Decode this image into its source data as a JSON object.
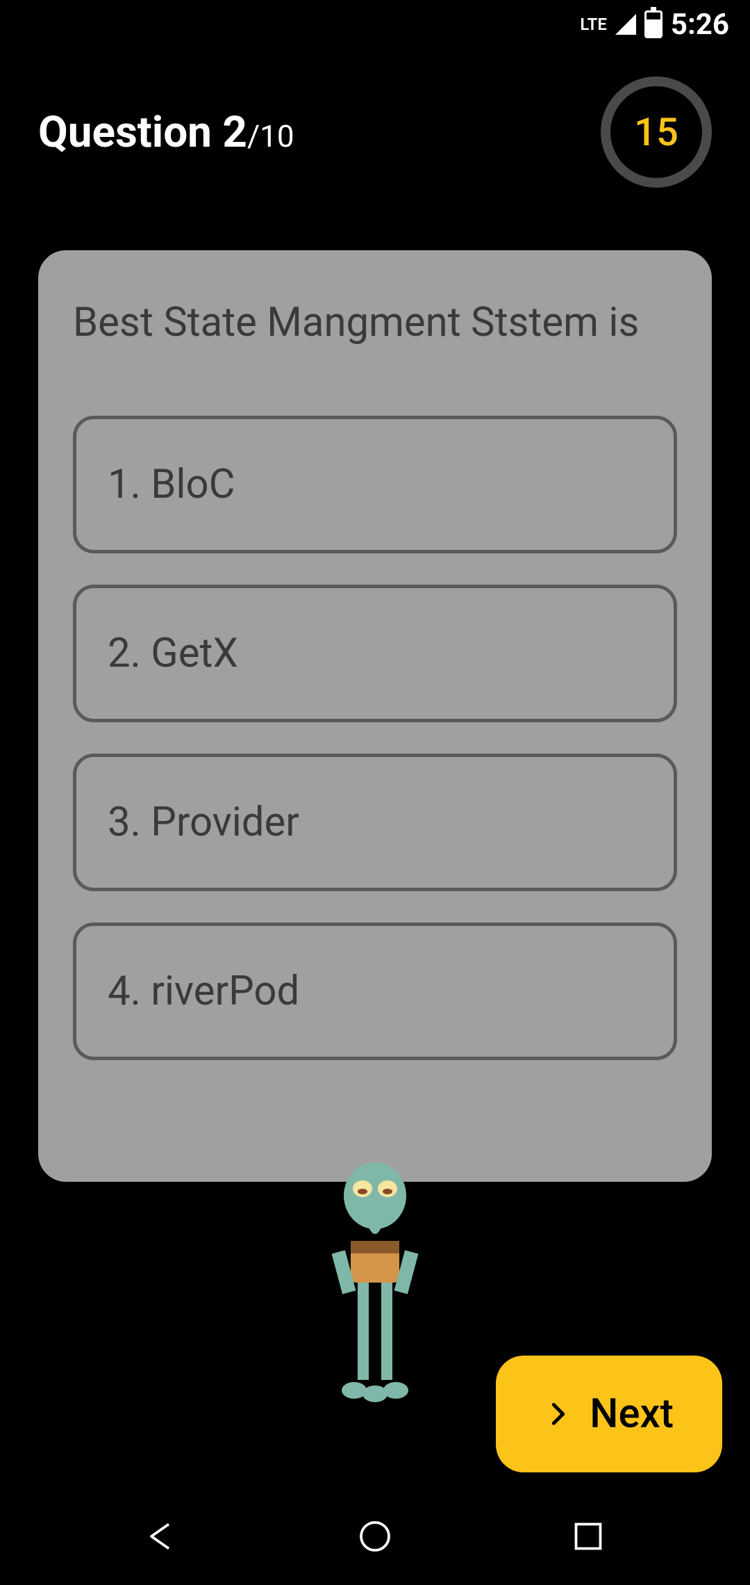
{
  "status_bar": {
    "network": "LTE",
    "time": "5:26"
  },
  "header": {
    "question_prefix": "Question ",
    "question_number": "2",
    "question_separator": "/",
    "question_total": "10",
    "timer": "15"
  },
  "question": {
    "text": "Best State Mangment Ststem is",
    "options": [
      "1. BloC",
      "2. GetX",
      "3. Provider",
      "4. riverPod"
    ]
  },
  "next_button": {
    "label": "Next"
  },
  "colors": {
    "accent": "#fcc419",
    "card_bg": "#a0a0a0",
    "text_dark": "#3a3a3a"
  }
}
